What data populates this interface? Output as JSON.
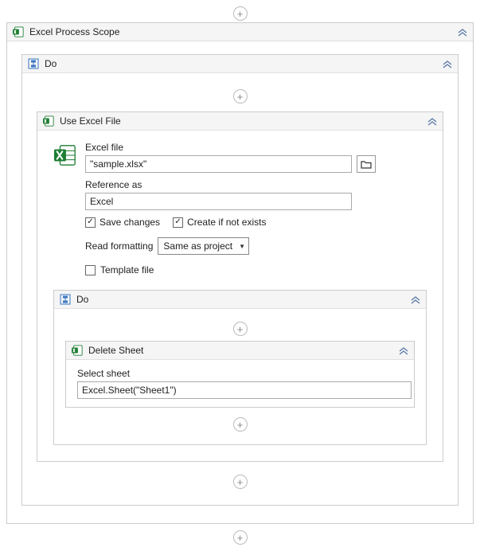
{
  "outer": {
    "title": "Excel Process Scope"
  },
  "doOuter": {
    "title": "Do"
  },
  "useExcel": {
    "title": "Use Excel File",
    "fileLabel": "Excel file",
    "fileValue": "\"sample.xlsx\"",
    "refLabel": "Reference as",
    "refValue": "Excel",
    "saveChanges": "Save changes",
    "createIfNot": "Create if not exists",
    "readFmtLabel": "Read formatting",
    "readFmtValue": "Same as project",
    "templateLabel": "Template file"
  },
  "doInner": {
    "title": "Do"
  },
  "deleteSheet": {
    "title": "Delete Sheet",
    "selectLabel": "Select sheet",
    "selectValue": "Excel.Sheet(\"Sheet1\")"
  }
}
